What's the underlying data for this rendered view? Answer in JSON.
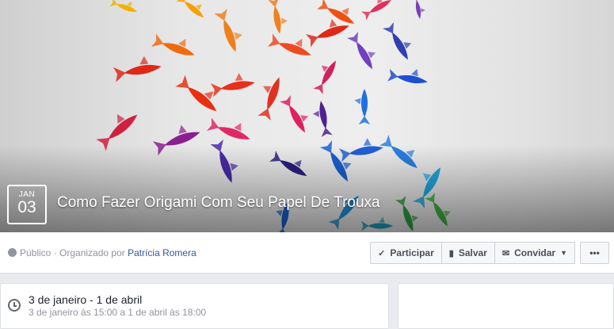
{
  "event": {
    "month": "JAN",
    "day": "03",
    "title": "Como Fazer Origami Com Seu Papel De Trouxa"
  },
  "meta": {
    "privacy": "Público",
    "separator": " · Organizado por ",
    "organizer": "Patrícia Romera"
  },
  "actions": {
    "participate": "Participar",
    "save": "Salvar",
    "invite": "Convidar",
    "more": "•••"
  },
  "details": {
    "date_range": "3 de janeiro - 1 de abril",
    "time_range": "3 de janeiro às 15:00 a 1 de abril às 18:00"
  },
  "colors": {
    "link": "#365899",
    "muted": "#90949c"
  }
}
